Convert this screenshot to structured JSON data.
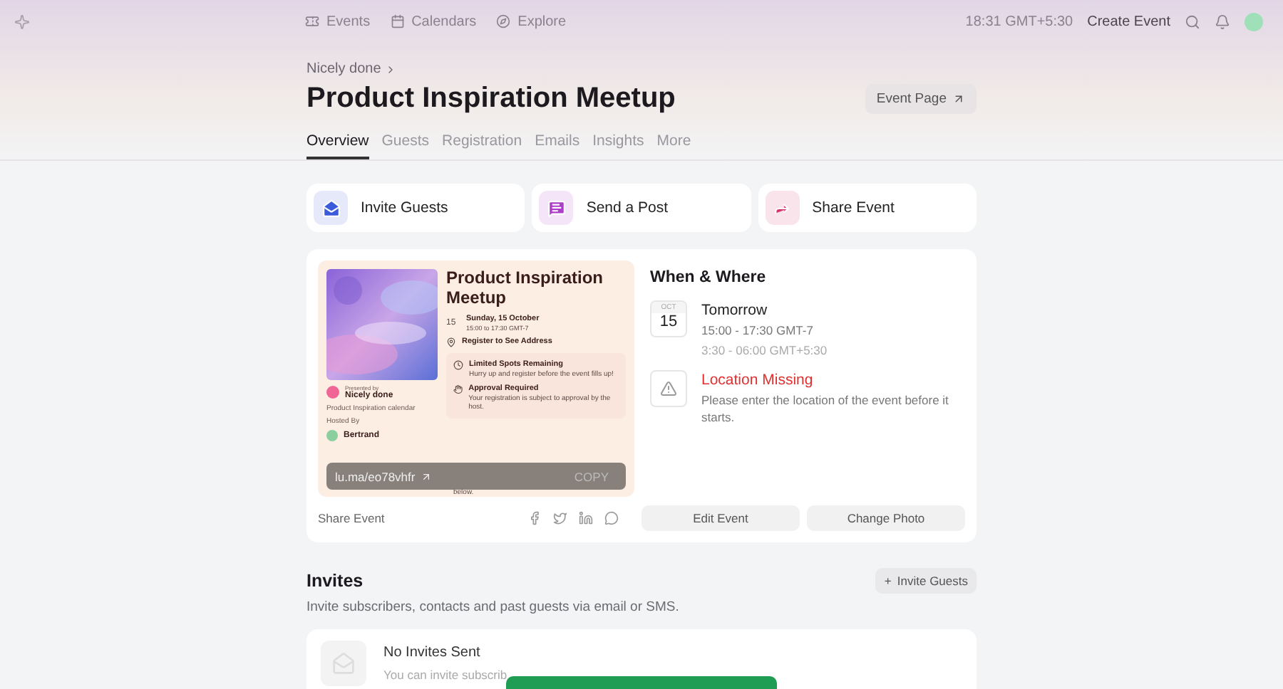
{
  "nav": {
    "links": [
      {
        "kind": "ticket",
        "label": "Events"
      },
      {
        "kind": "calendar",
        "label": "Calendars"
      },
      {
        "kind": "compass",
        "label": "Explore"
      }
    ],
    "time": "18:31 GMT+5:30",
    "create": "Create Event"
  },
  "breadcrumb": "Nicely done",
  "title": "Product Inspiration Meetup",
  "event_page_button": "Event Page",
  "tabs": [
    {
      "label": "Overview",
      "selected": true
    },
    {
      "label": "Guests",
      "selected": false
    },
    {
      "label": "Registration",
      "selected": false
    },
    {
      "label": "Emails",
      "selected": false
    },
    {
      "label": "Insights",
      "selected": false
    },
    {
      "label": "More",
      "selected": false
    }
  ],
  "actions": [
    {
      "kind": "invite",
      "label": "Invite Guests",
      "color": "#3b5bdb"
    },
    {
      "kind": "post",
      "label": "Send a Post",
      "color": "#ae3ec9"
    },
    {
      "kind": "share",
      "label": "Share Event",
      "color": "#d6336c"
    }
  ],
  "preview": {
    "title": "Product Inspiration Meetup",
    "day": "15",
    "date": "Sunday, 15 October",
    "time": "15:00 to 17:30 GMT-7",
    "address": "Register to See Address",
    "presented_by": "Presented by",
    "host_name": "Nicely done",
    "calendar": "Product Inspiration calendar",
    "hosted_by": "Hosted By",
    "host": "Bertrand",
    "notices": [
      {
        "kind": "clock",
        "title": "Limited Spots Remaining",
        "text": "Hurry up and register before the event fills up!"
      },
      {
        "kind": "hand",
        "title": "Approval Required",
        "text": "Your registration is subject to approval by the host."
      }
    ],
    "tail": "below.",
    "link": "lu.ma/eo78vhfr",
    "copy": "COPY"
  },
  "share": {
    "label": "Share Event",
    "networks": [
      {
        "kind": "facebook"
      },
      {
        "kind": "twitter"
      },
      {
        "kind": "linkedin"
      },
      {
        "kind": "chat"
      }
    ]
  },
  "when_where": {
    "heading": "When & Where",
    "month": "OCT",
    "day": "15",
    "when": "Tomorrow",
    "time": "15:00 - 17:30 GMT-7",
    "local_time": "3:30 - 06:00 GMT+5:30",
    "location_title": "Location Missing",
    "location_text": "Please enter the location of the event before it starts."
  },
  "card_buttons": [
    "Edit Event",
    "Change Photo"
  ],
  "invites": {
    "heading": "Invites",
    "button": "Invite Guests",
    "button_icon": "+",
    "subtitle": "Invite subscribers, contacts and past guests via email or SMS.",
    "empty_title": "No Invites Sent",
    "empty_text": "You can invite subscrib"
  }
}
